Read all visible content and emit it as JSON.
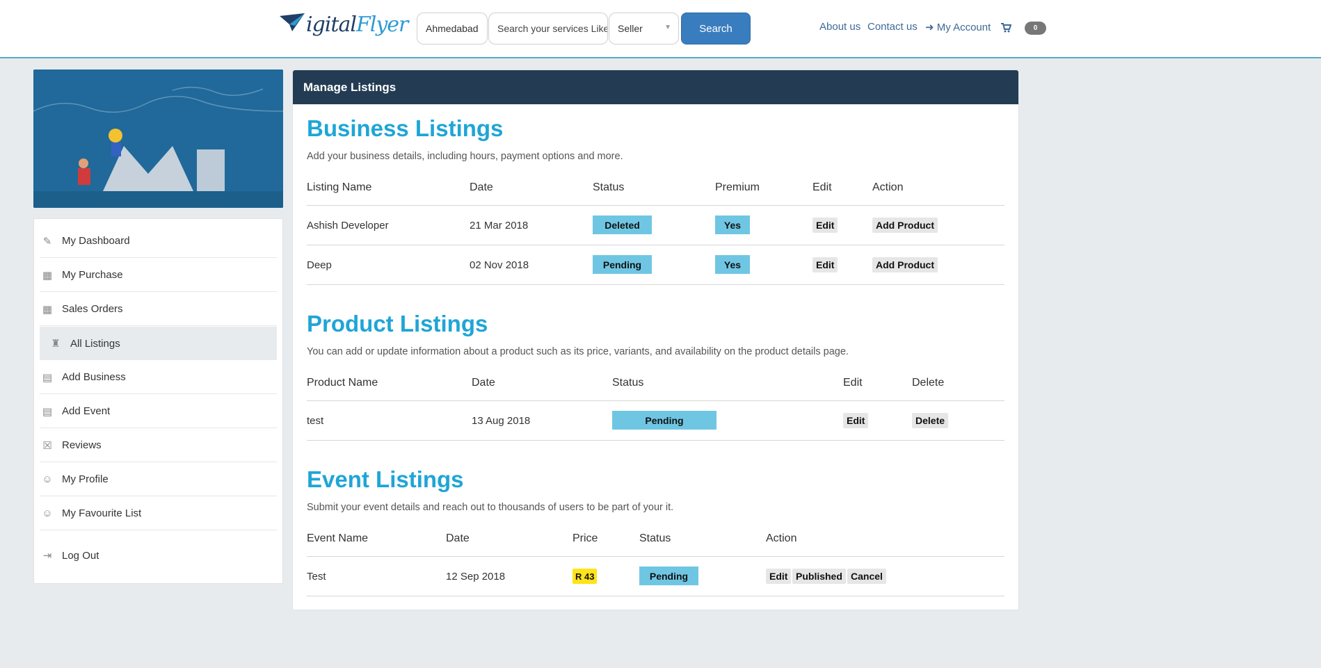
{
  "header": {
    "logo_main": "igital",
    "logo_accent": "Flyer",
    "city_value": "Ahmedabad",
    "search_placeholder": "Search your services Like",
    "type_value": "Seller",
    "search_label": "Search",
    "nav_about": "About us",
    "nav_contact": "Contact us",
    "nav_account": "My Account",
    "cart_count": "0"
  },
  "sidebar": {
    "items": [
      {
        "label": "My Dashboard",
        "icon": "dashboard-icon"
      },
      {
        "label": "My Purchase",
        "icon": "purchase-icon"
      },
      {
        "label": "Sales Orders",
        "icon": "orders-icon"
      },
      {
        "label": "All Listings",
        "icon": "listings-icon"
      },
      {
        "label": "Add Business",
        "icon": "business-icon"
      },
      {
        "label": "Add Event",
        "icon": "event-icon"
      },
      {
        "label": "Reviews",
        "icon": "reviews-icon"
      },
      {
        "label": "My Profile",
        "icon": "profile-icon"
      },
      {
        "label": "My Favourite List",
        "icon": "favourite-icon"
      },
      {
        "label": "Log Out",
        "icon": "logout-icon"
      }
    ]
  },
  "panel": {
    "title": "Manage Listings",
    "business": {
      "title": "Business Listings",
      "desc": "Add your business details, including hours, payment options and more.",
      "headers": [
        "Listing Name",
        "Date",
        "Status",
        "Premium",
        "Edit",
        "Action"
      ],
      "rows": [
        {
          "name": "Ashish Developer",
          "date": "21 Mar 2018",
          "status": "Deleted",
          "premium": "Yes",
          "edit": "Edit",
          "action": "Add Product"
        },
        {
          "name": "Deep",
          "date": "02 Nov 2018",
          "status": "Pending",
          "premium": "Yes",
          "edit": "Edit",
          "action": "Add Product"
        }
      ]
    },
    "product": {
      "title": "Product Listings",
      "desc": "You can add or update information about a product such as its price, variants, and availability on the product details page.",
      "headers": [
        "Product Name",
        "Date",
        "Status",
        "Edit",
        "Delete"
      ],
      "rows": [
        {
          "name": "test",
          "date": "13 Aug 2018",
          "status": "Pending",
          "edit": "Edit",
          "delete": "Delete"
        }
      ]
    },
    "event": {
      "title": "Event Listings",
      "desc": "Submit your event details and reach out to thousands of users to be part of your it.",
      "headers": [
        "Event Name",
        "Date",
        "Price",
        "Status",
        "Action"
      ],
      "rows": [
        {
          "name": "Test",
          "date": "12 Sep 2018",
          "price": "R 43",
          "status": "Pending",
          "edit": "Edit",
          "published": "Published",
          "cancel": "Cancel"
        }
      ]
    }
  },
  "colors": {
    "accent_blue": "#1fa5d6",
    "panel_header": "#233c53",
    "status_tag": "#6fc6e3",
    "price_tag": "#ffe31a",
    "search_button": "#3a7dbf"
  }
}
